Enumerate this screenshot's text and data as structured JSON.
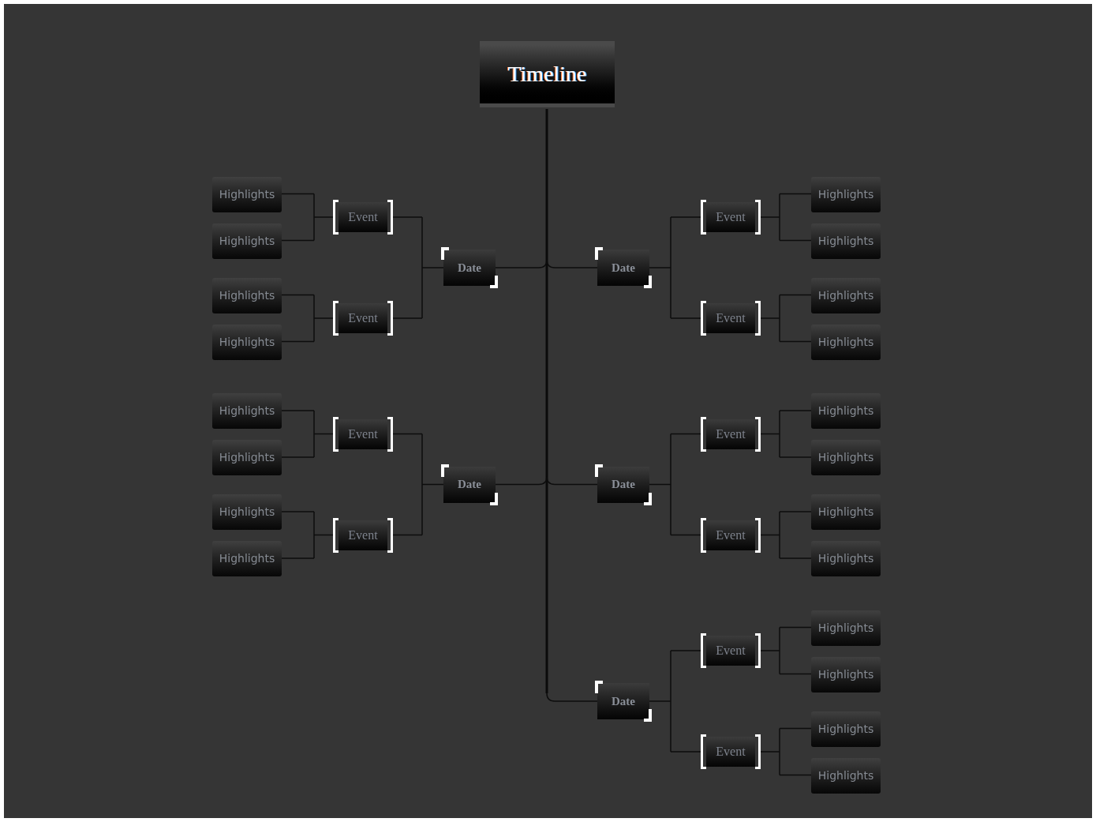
{
  "title": "Timeline",
  "left_branches": [
    {
      "date": "Date",
      "events": [
        {
          "label": "Event",
          "highlights": [
            "Highlights",
            "Highlights"
          ]
        },
        {
          "label": "Event",
          "highlights": [
            "Highlights",
            "Highlights"
          ]
        }
      ]
    },
    {
      "date": "Date",
      "events": [
        {
          "label": "Event",
          "highlights": [
            "Highlights",
            "Highlights"
          ]
        },
        {
          "label": "Event",
          "highlights": [
            "Highlights",
            "Highlights"
          ]
        }
      ]
    }
  ],
  "right_branches": [
    {
      "date": "Date",
      "events": [
        {
          "label": "Event",
          "highlights": [
            "Highlights",
            "Highlights"
          ]
        },
        {
          "label": "Event",
          "highlights": [
            "Highlights",
            "Highlights"
          ]
        }
      ]
    },
    {
      "date": "Date",
      "events": [
        {
          "label": "Event",
          "highlights": [
            "Highlights",
            "Highlights"
          ]
        },
        {
          "label": "Event",
          "highlights": [
            "Highlights",
            "Highlights"
          ]
        }
      ]
    },
    {
      "date": "Date",
      "events": [
        {
          "label": "Event",
          "highlights": [
            "Highlights",
            "Highlights"
          ]
        },
        {
          "label": "Event",
          "highlights": [
            "Highlights",
            "Highlights"
          ]
        }
      ]
    }
  ]
}
